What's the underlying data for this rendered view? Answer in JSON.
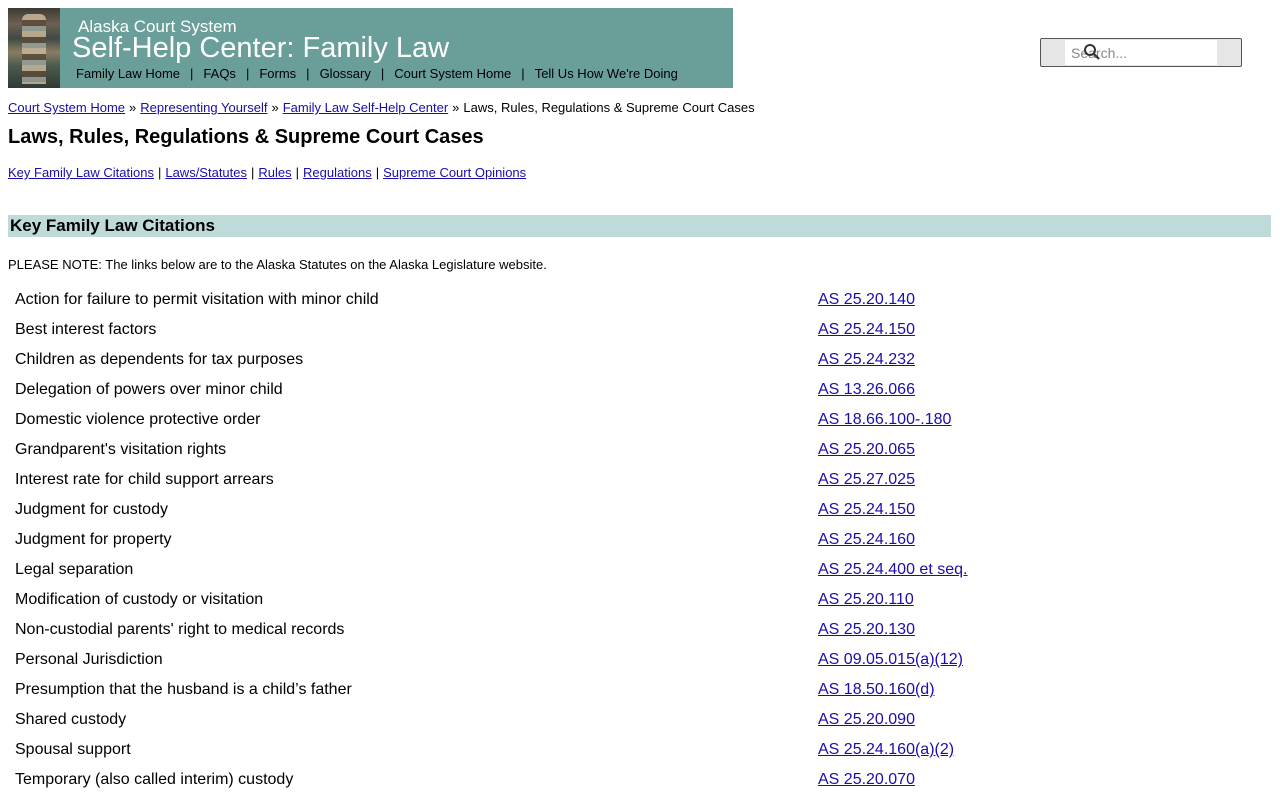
{
  "banner": {
    "org": "Alaska Court System",
    "title": "Self-Help Center: Family Law",
    "nav": [
      "Family Law Home",
      "FAQs",
      "Forms",
      "Glossary",
      "Court System Home",
      "Tell Us How We're Doing"
    ]
  },
  "search": {
    "placeholder": "Search..."
  },
  "breadcrumb": {
    "links": [
      "Court System Home",
      "Representing Yourself",
      "Family Law Self-Help Center"
    ],
    "current": "Laws, Rules, Regulations & Supreme Court Cases"
  },
  "page": {
    "title": "Laws, Rules, Regulations & Supreme Court Cases"
  },
  "subnav": [
    "Key Family Law Citations",
    "Laws/Statutes",
    "Rules",
    "Regulations",
    "Supreme Court Opinions"
  ],
  "section": {
    "heading": "Key Family Law Citations",
    "note": "PLEASE NOTE: The links below are to the Alaska Statutes on the Alaska Legislature website."
  },
  "citations": [
    {
      "topic": "Action for failure to permit visitation with minor child",
      "cite": "AS 25.20.140"
    },
    {
      "topic": "Best interest factors",
      "cite": "AS 25.24.150"
    },
    {
      "topic": "Children as dependents for tax purposes",
      "cite": "AS 25.24.232"
    },
    {
      "topic": "Delegation of powers over minor child",
      "cite": "AS 13.26.066"
    },
    {
      "topic": "Domestic violence protective order",
      "cite": "AS 18.66.100-.180"
    },
    {
      "topic": "Grandparent's visitation rights",
      "cite": "AS 25.20.065"
    },
    {
      "topic": "Interest rate for child support arrears",
      "cite": "AS 25.27.025"
    },
    {
      "topic": "Judgment for custody",
      "cite": "AS 25.24.150"
    },
    {
      "topic": "Judgment for property",
      "cite": "AS 25.24.160"
    },
    {
      "topic": "Legal separation",
      "cite": "AS 25.24.400 et seq."
    },
    {
      "topic": "Modification of custody or visitation",
      "cite": "AS 25.20.110"
    },
    {
      "topic": "Non-custodial parents' right to medical records",
      "cite": "AS 25.20.130"
    },
    {
      "topic": "Personal Jurisdiction",
      "cite": "AS 09.05.015(a)(12)"
    },
    {
      "topic": "Presumption that the husband is a child’s father",
      "cite": "AS 18.50.160(d)"
    },
    {
      "topic": "Shared custody",
      "cite": "AS 25.20.090"
    },
    {
      "topic": "Spousal support",
      "cite": "AS 25.24.160(a)(2)"
    },
    {
      "topic": "Temporary (also called interim) custody",
      "cite": "AS 25.20.070"
    }
  ],
  "colors": {
    "banner": "#6a9e99",
    "section_bar": "#bfdbd9",
    "link": "#1a0dab"
  }
}
